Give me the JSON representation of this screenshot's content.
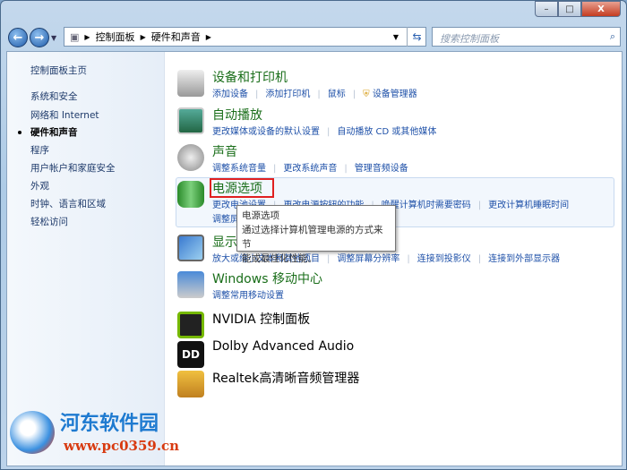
{
  "window": {
    "min": "–",
    "max": "□",
    "close": "X"
  },
  "breadcrumb": [
    "控制面板",
    "硬件和声音"
  ],
  "search": {
    "placeholder": "搜索控制面板"
  },
  "sidebar": {
    "items": [
      {
        "label": "控制面板主页"
      },
      {
        "label": "系统和安全"
      },
      {
        "label": "网络和 Internet"
      },
      {
        "label": "硬件和声音",
        "current": true
      },
      {
        "label": "程序"
      },
      {
        "label": "用户帐户和家庭安全"
      },
      {
        "label": "外观"
      },
      {
        "label": "时钟、语言和区域"
      },
      {
        "label": "轻松访问"
      }
    ]
  },
  "categories": [
    {
      "title": "设备和打印机",
      "links": [
        "添加设备",
        "添加打印机",
        "鼠标",
        "设备管理器"
      ]
    },
    {
      "title": "自动播放",
      "links": [
        "更改媒体或设备的默认设置",
        "自动播放 CD 或其他媒体"
      ]
    },
    {
      "title": "声音",
      "links": [
        "调整系统音量",
        "更改系统声音",
        "管理音频设备"
      ]
    },
    {
      "title": "电源选项",
      "links": [
        "更改电池设置",
        "更改电源按钮的功能",
        "唤醒计算机时需要密码",
        "更改计算机睡眠时间"
      ],
      "links2": [
        "调整屏"
      ]
    },
    {
      "title": "显示",
      "links": [
        "放大或缩小文本和其他项目",
        "调整屏幕分辨率",
        "连接到投影仪",
        "连接到外部显示器"
      ]
    },
    {
      "title": "Windows 移动中心",
      "links": [
        "调整常用移动设置"
      ]
    },
    {
      "title": "NVIDIA 控制面板",
      "links": []
    },
    {
      "title": "Dolby Advanced Audio",
      "links": []
    },
    {
      "title": "Realtek高清晰音频管理器",
      "links": []
    }
  ],
  "tooltip": {
    "title": "电源选项",
    "line1": "通过选择计算机管理电源的方式来节",
    "line2": "能或最佳化性能。"
  },
  "watermark": {
    "name": "河东软件园",
    "url": "www.pc0359.cn"
  }
}
